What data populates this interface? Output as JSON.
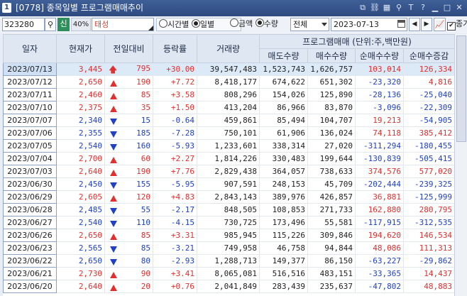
{
  "window": {
    "number": "1",
    "title": "[0778] 종목일별 프로그램매매추이",
    "icons": [
      "copy-icon",
      "link-icon",
      "layout-icon",
      "pin-icon",
      "text-icon",
      "help-icon",
      "minimize-icon",
      "maximize-icon",
      "close-icon"
    ]
  },
  "toolbar": {
    "code": "323280",
    "badge": "신",
    "rate": "40%",
    "name": "태성",
    "period_options": [
      "시간별",
      "일별"
    ],
    "period_selected": "일별",
    "unit_options": [
      "금액",
      "수량"
    ],
    "unit_selected": "수량",
    "scope": "전체",
    "date": "2023-07-13",
    "check_label": "종가",
    "checked": true
  },
  "table": {
    "headers": {
      "date": "일자",
      "price": "현재가",
      "change": "전일대비",
      "rate": "등락률",
      "volume": "거래량",
      "group": "프로그램매매 (단위:주,백만원)",
      "sell": "매도수량",
      "buy": "매수수량",
      "net": "순매수수량",
      "net_change": "순매수증감"
    },
    "rows": [
      {
        "date": "2023/07/13",
        "price": "3,445",
        "change": "795",
        "dir": "limit",
        "rate": "+30.00",
        "volume": "39,547,483",
        "sell": "1,523,743",
        "buy": "1,626,757",
        "net": "103,014",
        "net_change": "126,334",
        "hl": true
      },
      {
        "date": "2023/07/12",
        "price": "2,650",
        "change": "190",
        "dir": "up",
        "rate": "+7.72",
        "volume": "8,418,177",
        "sell": "674,622",
        "buy": "651,302",
        "net": "-23,320",
        "net_change": "4,816"
      },
      {
        "date": "2023/07/11",
        "price": "2,460",
        "change": "85",
        "dir": "up",
        "rate": "+3.58",
        "volume": "808,296",
        "sell": "154,026",
        "buy": "125,890",
        "net": "-28,136",
        "net_change": "-25,040"
      },
      {
        "date": "2023/07/10",
        "price": "2,375",
        "change": "35",
        "dir": "up",
        "rate": "+1.50",
        "volume": "413,204",
        "sell": "86,966",
        "buy": "83,870",
        "net": "-3,096",
        "net_change": "-22,309"
      },
      {
        "date": "2023/07/07",
        "price": "2,340",
        "change": "15",
        "dir": "down",
        "rate": "-0.64",
        "volume": "459,861",
        "sell": "85,494",
        "buy": "104,707",
        "net": "19,213",
        "net_change": "-54,905"
      },
      {
        "date": "2023/07/06",
        "price": "2,355",
        "change": "185",
        "dir": "down",
        "rate": "-7.28",
        "volume": "750,101",
        "sell": "61,906",
        "buy": "136,024",
        "net": "74,118",
        "net_change": "385,412"
      },
      {
        "date": "2023/07/05",
        "price": "2,540",
        "change": "160",
        "dir": "down",
        "rate": "-5.93",
        "volume": "1,233,601",
        "sell": "338,314",
        "buy": "27,020",
        "net": "-311,294",
        "net_change": "-180,455"
      },
      {
        "date": "2023/07/04",
        "price": "2,700",
        "change": "60",
        "dir": "up",
        "rate": "+2.27",
        "volume": "1,814,226",
        "sell": "330,483",
        "buy": "199,644",
        "net": "-130,839",
        "net_change": "-505,415"
      },
      {
        "date": "2023/07/03",
        "price": "2,640",
        "change": "190",
        "dir": "up",
        "rate": "+7.76",
        "volume": "2,829,438",
        "sell": "364,057",
        "buy": "738,633",
        "net": "374,576",
        "net_change": "577,020"
      },
      {
        "date": "2023/06/30",
        "price": "2,450",
        "change": "155",
        "dir": "down",
        "rate": "-5.95",
        "volume": "907,591",
        "sell": "248,153",
        "buy": "45,709",
        "net": "-202,444",
        "net_change": "-239,325"
      },
      {
        "date": "2023/06/29",
        "price": "2,605",
        "change": "120",
        "dir": "up",
        "rate": "+4.83",
        "volume": "2,843,143",
        "sell": "389,976",
        "buy": "426,857",
        "net": "36,881",
        "net_change": "-125,999"
      },
      {
        "date": "2023/06/28",
        "price": "2,485",
        "change": "55",
        "dir": "down",
        "rate": "-2.17",
        "volume": "848,505",
        "sell": "108,853",
        "buy": "271,733",
        "net": "162,880",
        "net_change": "280,795"
      },
      {
        "date": "2023/06/27",
        "price": "2,540",
        "change": "110",
        "dir": "down",
        "rate": "-4.15",
        "volume": "730,725",
        "sell": "173,496",
        "buy": "55,581",
        "net": "-117,915",
        "net_change": "-312,535"
      },
      {
        "date": "2023/06/26",
        "price": "2,650",
        "change": "85",
        "dir": "up",
        "rate": "+3.31",
        "volume": "985,945",
        "sell": "115,226",
        "buy": "309,846",
        "net": "194,620",
        "net_change": "146,534"
      },
      {
        "date": "2023/06/23",
        "price": "2,565",
        "change": "85",
        "dir": "down",
        "rate": "-3.21",
        "volume": "749,958",
        "sell": "46,758",
        "buy": "94,844",
        "net": "48,086",
        "net_change": "111,313"
      },
      {
        "date": "2023/06/22",
        "price": "2,650",
        "change": "80",
        "dir": "down",
        "rate": "-2.93",
        "volume": "1,288,713",
        "sell": "149,377",
        "buy": "86,150",
        "net": "-63,227",
        "net_change": "-29,862"
      },
      {
        "date": "2023/06/21",
        "price": "2,730",
        "change": "90",
        "dir": "up",
        "rate": "+3.41",
        "volume": "8,065,081",
        "sell": "516,516",
        "buy": "483,151",
        "net": "-33,365",
        "net_change": "14,437"
      },
      {
        "date": "2023/06/20",
        "price": "2,640",
        "change": "20",
        "dir": "up",
        "rate": "+0.76",
        "volume": "2,041,849",
        "sell": "283,439",
        "buy": "235,637",
        "net": "-47,802",
        "net_change": "48,883"
      }
    ]
  },
  "colors": {
    "up": "#e03030",
    "down": "#2140c8",
    "header_bg": "#dfe7f3",
    "title_bg": "#2e4b80"
  }
}
